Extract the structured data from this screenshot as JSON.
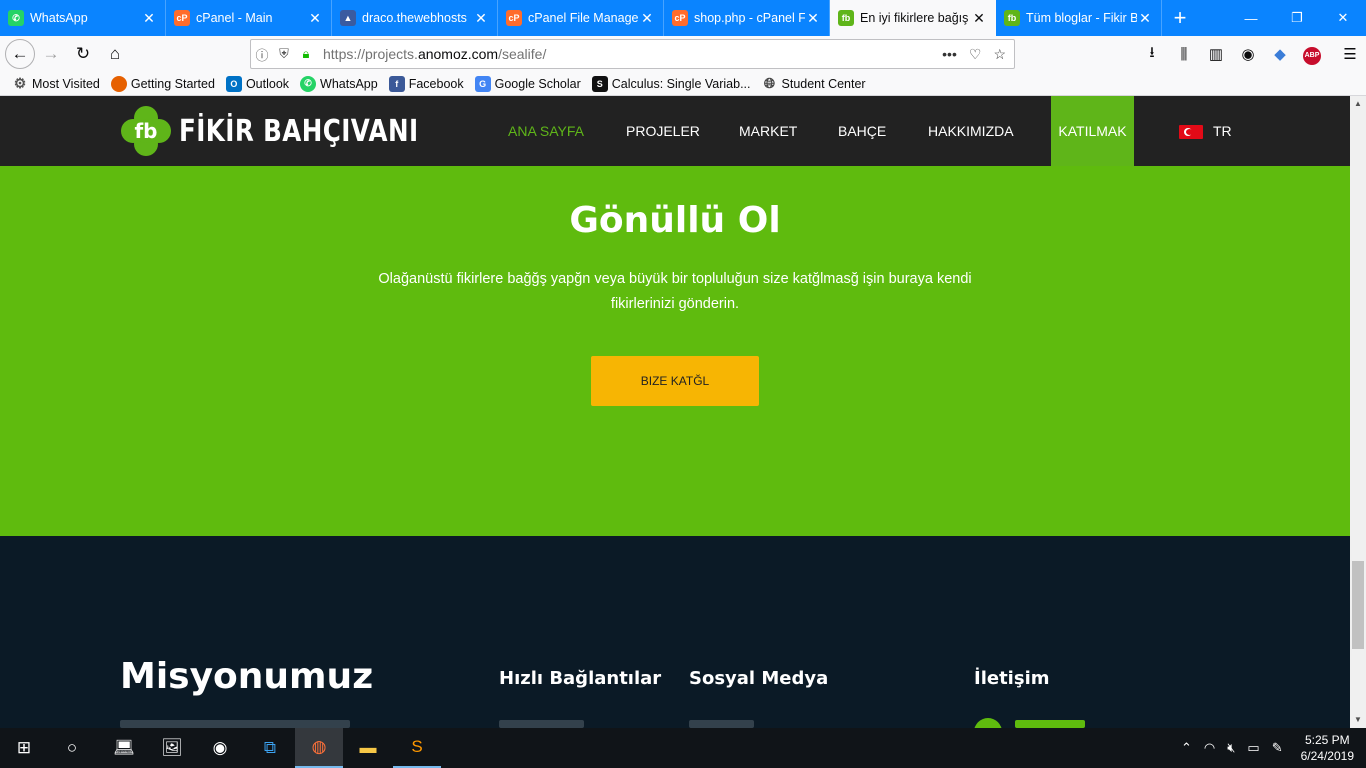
{
  "browser": {
    "tabs": [
      {
        "title": "WhatsApp",
        "icon": "whatsapp-icon",
        "color": "#25d366"
      },
      {
        "title": "cPanel - Main",
        "icon": "cpanel-icon",
        "color": "#ff6c2c"
      },
      {
        "title": "draco.thewebhosts",
        "icon": "hosting-icon",
        "color": "#3a5ba0"
      },
      {
        "title": "cPanel File Manager",
        "icon": "cpanel-icon",
        "color": "#ff6c2c"
      },
      {
        "title": "shop.php - cPanel F",
        "icon": "cpanel-icon",
        "color": "#ff6c2c"
      },
      {
        "title": "En iyi fikirlere bağış",
        "icon": "fb-icon",
        "color": "#5fb519"
      },
      {
        "title": "Tüm bloglar - Fikir B",
        "icon": "fb-icon",
        "color": "#5fb519"
      }
    ],
    "url_prefix": "https://projects.",
    "url_domain": "anomoz.com",
    "url_path": "/sealife/",
    "bookmarks": [
      {
        "label": "Most Visited",
        "icon": "gear-icon",
        "color": "#555555"
      },
      {
        "label": "Getting Started",
        "icon": "firefox-icon",
        "color": "#e66000"
      },
      {
        "label": "Outlook",
        "icon": "outlook-icon",
        "color": "#0072c6"
      },
      {
        "label": "WhatsApp",
        "icon": "whatsapp-icon",
        "color": "#25d366"
      },
      {
        "label": "Facebook",
        "icon": "facebook-icon",
        "color": "#3b5998"
      },
      {
        "label": "Google Scholar",
        "icon": "scholar-icon",
        "color": "#4285f4"
      },
      {
        "label": "Calculus: Single Variab...",
        "icon": "course-icon",
        "color": "#111111"
      },
      {
        "label": "Student Center",
        "icon": "globe-icon",
        "color": "#444444"
      }
    ]
  },
  "site": {
    "brand": "FİKİR BAHÇIVANI",
    "brand_mark": "fb",
    "menu": [
      "ANA SAYFA",
      "PROJELER",
      "MARKET",
      "BAHÇE",
      "HAKKIMIZDA",
      "KATILMAK",
      "TR"
    ],
    "volunteer": {
      "title": "Gönüllü Ol",
      "text": "Olağanüstü fikirlere bağğş yapğn veya büyük bir topluluğun size katğlmasğ işin buraya kendi fikirlerinizi gönderin.",
      "button": "BIZE KATĞL"
    },
    "footer": {
      "mission": "Misyonumuz",
      "quick_links": "Hızlı Bağlantılar",
      "social": "Sosyal Medya",
      "contact": "İletişim"
    },
    "colors": {
      "brand_green": "#5fbb0e",
      "cta_yellow": "#f7b503",
      "header_bg": "#222222",
      "footer_bg": "#0b1a26"
    }
  },
  "taskbar": {
    "time": "5:25 PM",
    "date": "6/24/2019"
  }
}
